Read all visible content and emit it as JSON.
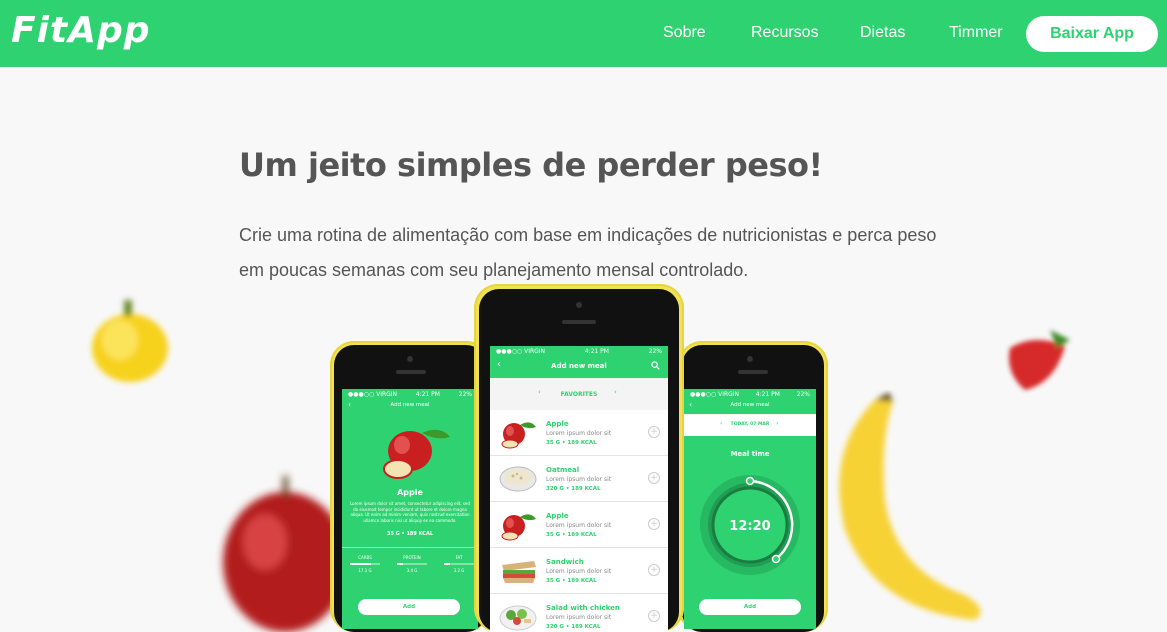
{
  "nav": {
    "logo": "FitApp",
    "links": [
      "Sobre",
      "Recursos",
      "Dietas",
      "Timmer"
    ],
    "cta": "Baixar App"
  },
  "hero": {
    "title": "Um jeito simples de perder peso!",
    "text": "Crie uma rotina de alimentação com base em indicações de nutricionistas e perca peso em poucas semanas com seu planejamento mensal controlado."
  },
  "phone_left": {
    "status_left": "●●●○○ VIRGIN",
    "status_time": "4:21 PM",
    "status_right": "22%",
    "title": "Add new meal",
    "food_name": "Apple",
    "food_desc": "Lorem ipsum dolor sit amet, consectetur adipiscing elit, sed do eiusmod tempor incididunt ut labore et dolore magna aliqua. Ut enim ad minim veniam, quis nostrud exercitation ullamco laboris nisi ut aliquip ex ea commodo.",
    "food_qty": "35 G  •  189 KCAL",
    "macros": [
      {
        "label": "CARBS",
        "value": "17.1 G",
        "fill": 0.7
      },
      {
        "label": "PROTEIN",
        "value": "3.4 G",
        "fill": 0.2
      },
      {
        "label": "FAT",
        "value": "3.2 G",
        "fill": 0.2
      }
    ],
    "add_button": "Add"
  },
  "phone_middle": {
    "status_left": "●●●○○ VIRGIN",
    "status_time": "4:21 PM",
    "status_right": "22%",
    "title": "Add new meal",
    "section": "FAVORITES",
    "meals": [
      {
        "name": "Apple",
        "desc": "Lorem ipsum dolor sit",
        "qty": "35 G  •  189 KCAL",
        "icon": "apple"
      },
      {
        "name": "Oatmeal",
        "desc": "Lorem ipsum dolor sit",
        "qty": "320 G  •  189 KCAL",
        "icon": "oatmeal"
      },
      {
        "name": "Apple",
        "desc": "Lorem ipsum dolor sit",
        "qty": "35 G  •  189 KCAL",
        "icon": "apple"
      },
      {
        "name": "Sandwich",
        "desc": "Lorem ipsum dolor sit",
        "qty": "35 G  •  189 KCAL",
        "icon": "sandwich"
      },
      {
        "name": "Salad with chicken",
        "desc": "Lorem ipsum dolor sit",
        "qty": "320 G  •  189 KCAL",
        "icon": "salad"
      }
    ]
  },
  "phone_right": {
    "status_left": "●●●○○ VIRGIN",
    "status_time": "4:21 PM",
    "status_right": "22%",
    "title": "Add new meal",
    "date": "TODAY, 07 MAR",
    "label": "Meal time",
    "time": "12:20",
    "add_button": "Add"
  },
  "colors": {
    "brand": "#2ed271",
    "text": "#555555",
    "phone": "#f0e254"
  }
}
